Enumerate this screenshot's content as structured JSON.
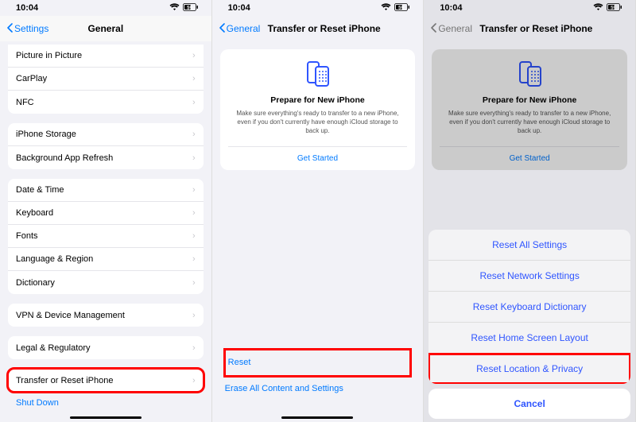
{
  "status": {
    "time": "10:04",
    "battery_label": "59"
  },
  "s1": {
    "back": "Settings",
    "title": "General",
    "groups": [
      {
        "items": [
          "Picture in Picture",
          "CarPlay",
          "NFC"
        ]
      },
      {
        "items": [
          "iPhone Storage",
          "Background App Refresh"
        ]
      },
      {
        "items": [
          "Date & Time",
          "Keyboard",
          "Fonts",
          "Language & Region",
          "Dictionary"
        ]
      },
      {
        "items": [
          "VPN & Device Management"
        ]
      },
      {
        "items": [
          "Legal & Regulatory"
        ]
      },
      {
        "items": [
          "Transfer or Reset iPhone"
        ],
        "highlight": true
      }
    ],
    "shutdown": "Shut Down"
  },
  "s2": {
    "back": "General",
    "title": "Transfer or Reset iPhone",
    "card": {
      "title": "Prepare for New iPhone",
      "desc": "Make sure everything's ready to transfer to a new iPhone, even if you don't currently have enough iCloud storage to back up.",
      "link": "Get Started"
    },
    "reset": "Reset",
    "erase": "Erase All Content and Settings"
  },
  "s3": {
    "back": "General",
    "title": "Transfer or Reset iPhone",
    "card": {
      "title": "Prepare for New iPhone",
      "desc": "Make sure everything's ready to transfer to a new iPhone, even if you don't currently have enough iCloud storage to back up.",
      "link": "Get Started"
    },
    "sheet": {
      "options": [
        "Reset All Settings",
        "Reset Network Settings",
        "Reset Keyboard Dictionary",
        "Reset Home Screen Layout",
        "Reset Location & Privacy"
      ],
      "cancel": "Cancel"
    }
  }
}
